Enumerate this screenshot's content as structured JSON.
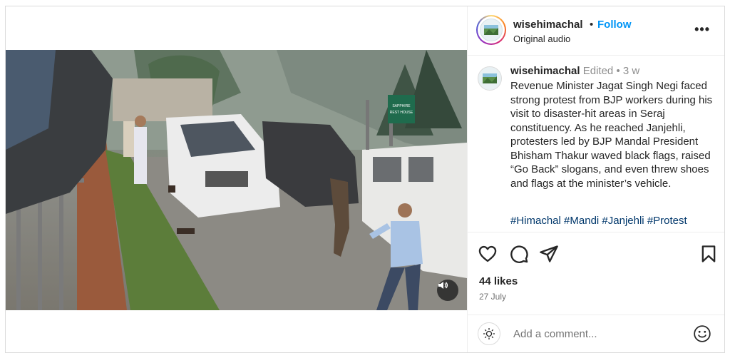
{
  "post": {
    "username": "wisehimachal",
    "dot": "•",
    "follow_label": "Follow",
    "audio": "Original audio",
    "more": "•••"
  },
  "caption": {
    "username": "wisehimachal",
    "edited": "Edited",
    "sep": "•",
    "age": "3 w",
    "text": "Revenue Minister Jagat Singh Negi faced strong protest from BJP workers during his visit to disaster-hit areas in Seraj constituency. As he reached Janjehli, protesters led by BJP Mandal President Bhisham Thakur waved black flags, raised “Go Back” slogans, and even threw shoes and flags at the minister’s vehicle.",
    "hashtags": [
      "#Himachal",
      "#Mandi",
      "#Janjehli",
      "#Protest"
    ]
  },
  "video": {
    "sign_text_1": "SAPPHIRE",
    "sign_text_2": "REST HOUSE"
  },
  "actions": {
    "like_icon": "heart-icon",
    "comment_icon": "comment-icon",
    "share_icon": "share-icon",
    "save_icon": "bookmark-icon",
    "likes": "44 likes",
    "date": "27 July"
  },
  "comment": {
    "placeholder": "Add a comment...",
    "emoji_icon": "smiley-icon"
  },
  "colors": {
    "follow": "#0095f6",
    "hashtag": "#00376b",
    "meta": "#8e8e8e"
  }
}
